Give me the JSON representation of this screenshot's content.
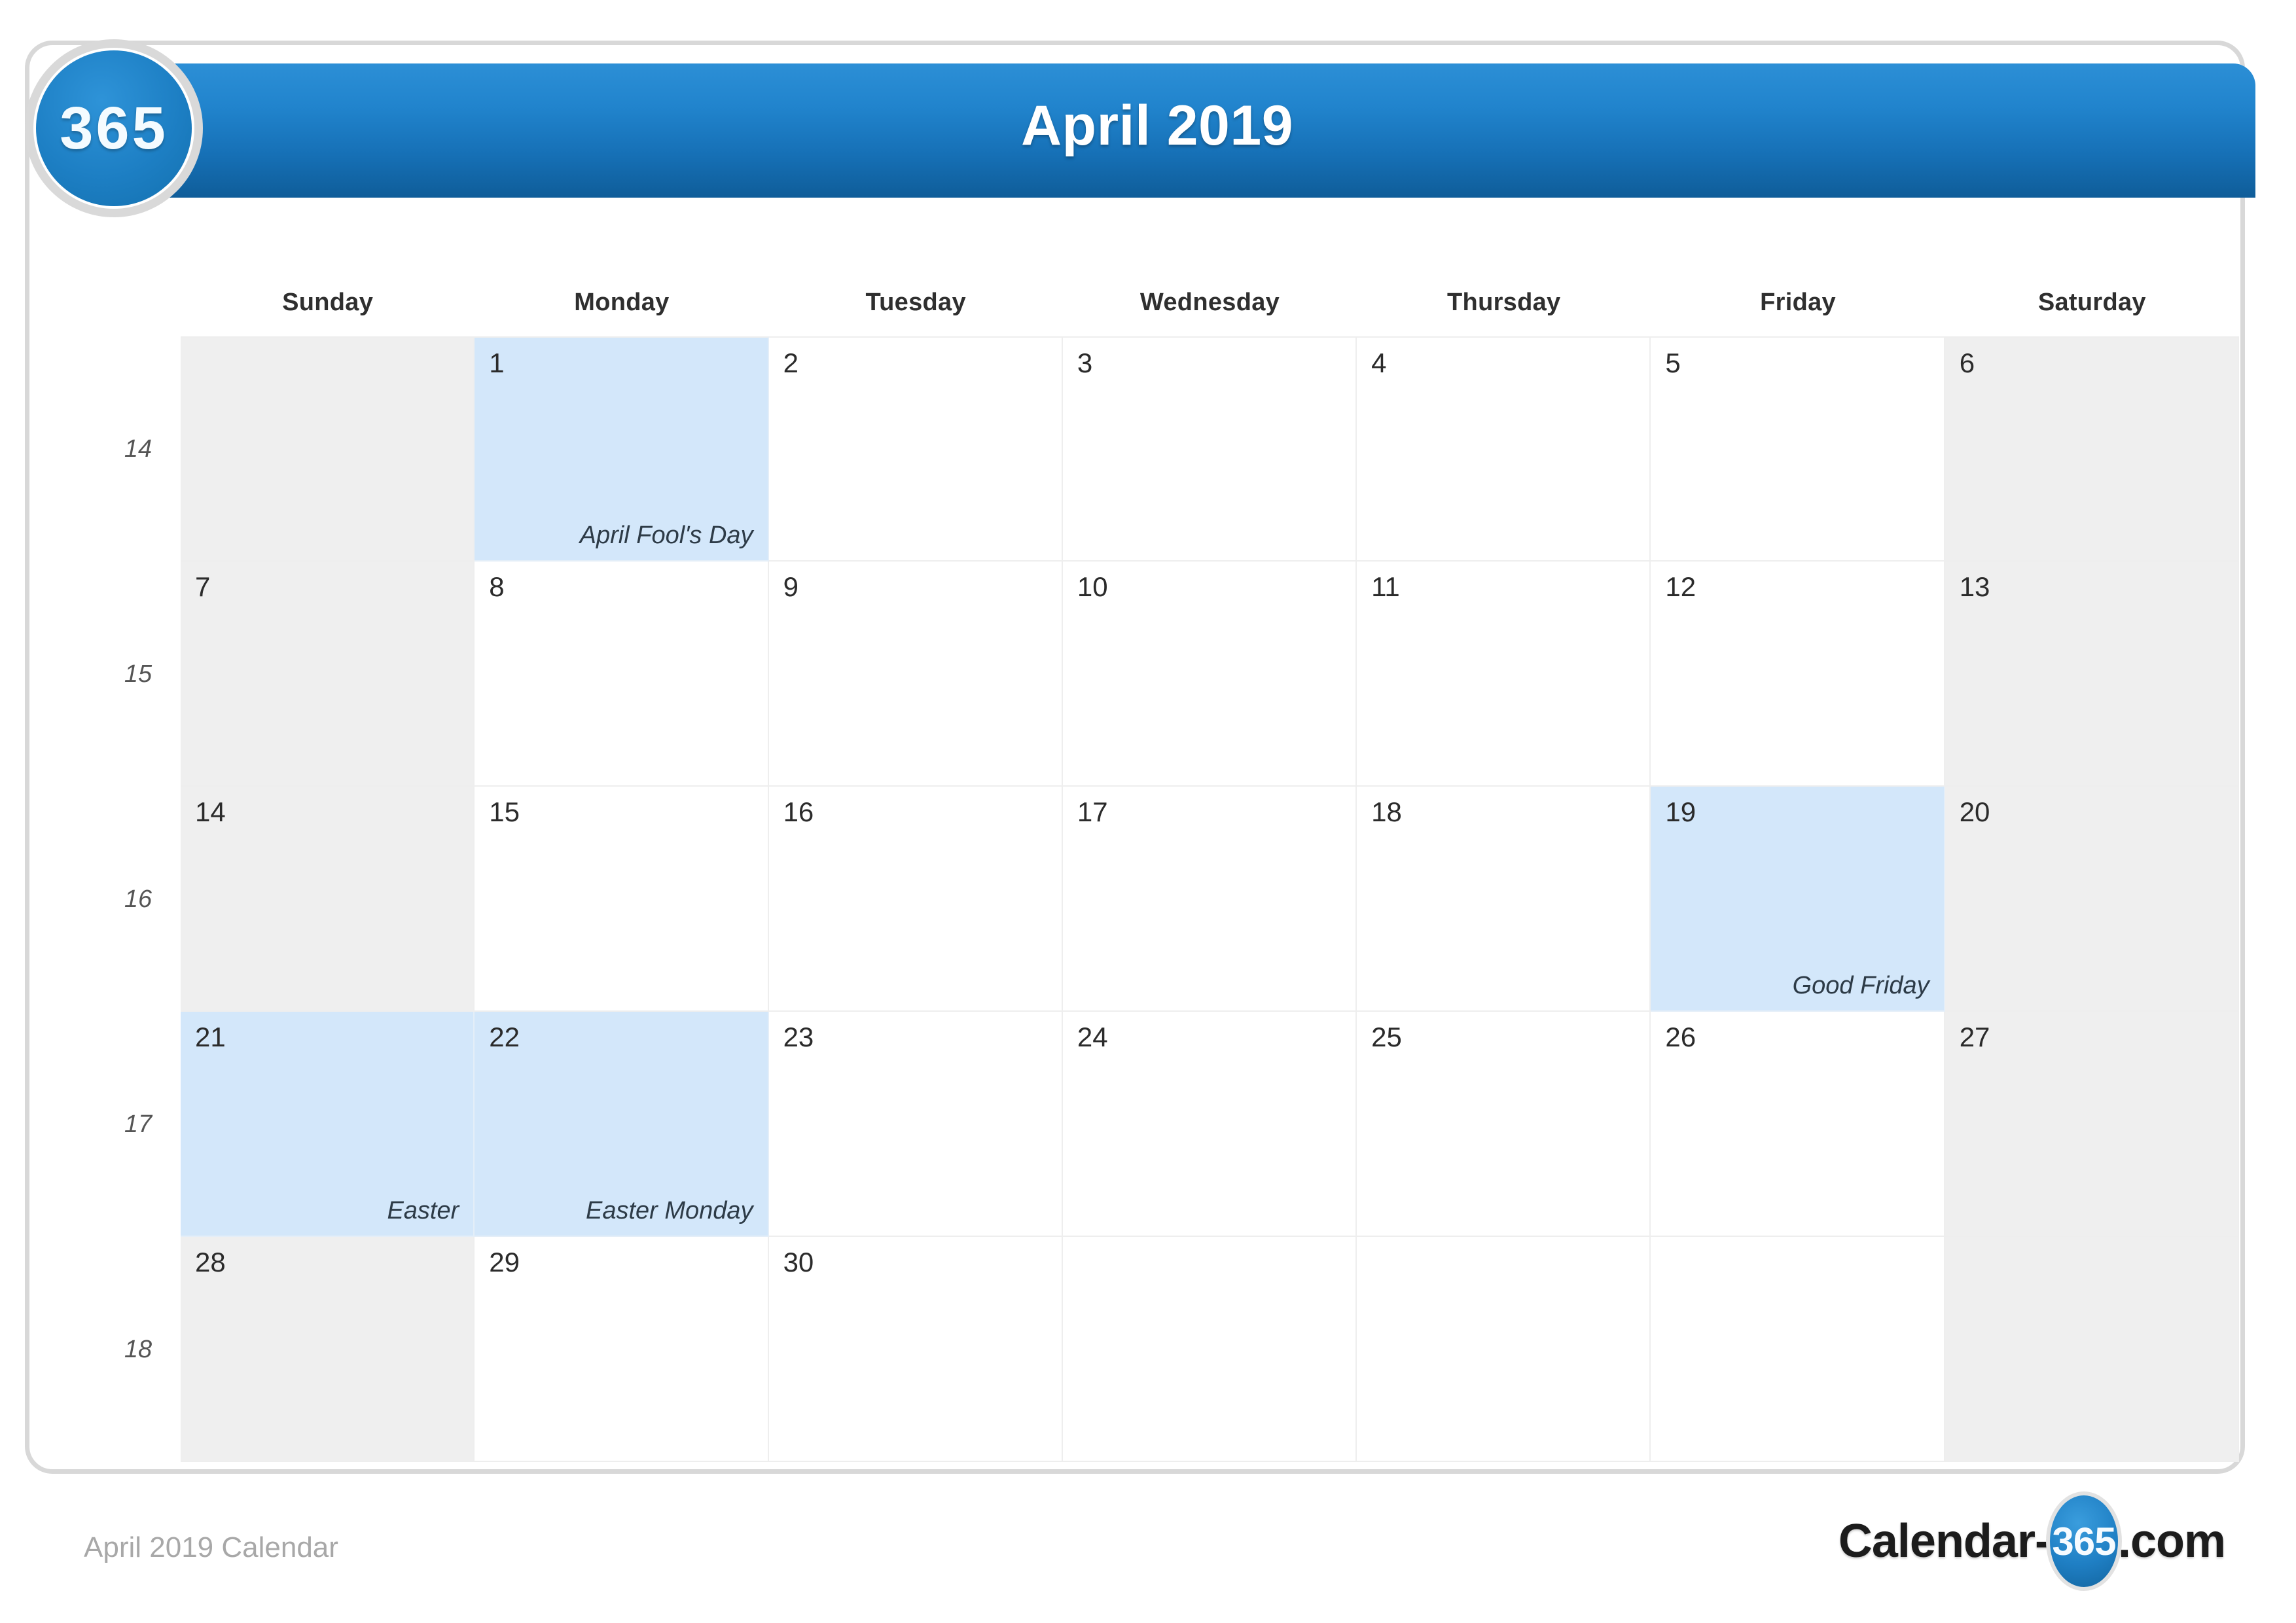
{
  "badge": {
    "label": "365"
  },
  "header": {
    "title": "April 2019"
  },
  "watermark": {
    "text": "365"
  },
  "weekdays": [
    {
      "label": "Sunday"
    },
    {
      "label": "Monday"
    },
    {
      "label": "Tuesday"
    },
    {
      "label": "Wednesday"
    },
    {
      "label": "Thursday"
    },
    {
      "label": "Friday"
    },
    {
      "label": "Saturday"
    }
  ],
  "weeks": [
    {
      "week_number": "14",
      "days": [
        {
          "number": "",
          "event": "",
          "weekend": true,
          "highlight": false
        },
        {
          "number": "1",
          "event": "April Fool's Day",
          "weekend": false,
          "highlight": true
        },
        {
          "number": "2",
          "event": "",
          "weekend": false,
          "highlight": false
        },
        {
          "number": "3",
          "event": "",
          "weekend": false,
          "highlight": false
        },
        {
          "number": "4",
          "event": "",
          "weekend": false,
          "highlight": false
        },
        {
          "number": "5",
          "event": "",
          "weekend": false,
          "highlight": false
        },
        {
          "number": "6",
          "event": "",
          "weekend": true,
          "highlight": false
        }
      ]
    },
    {
      "week_number": "15",
      "days": [
        {
          "number": "7",
          "event": "",
          "weekend": true,
          "highlight": false
        },
        {
          "number": "8",
          "event": "",
          "weekend": false,
          "highlight": false
        },
        {
          "number": "9",
          "event": "",
          "weekend": false,
          "highlight": false
        },
        {
          "number": "10",
          "event": "",
          "weekend": false,
          "highlight": false
        },
        {
          "number": "11",
          "event": "",
          "weekend": false,
          "highlight": false
        },
        {
          "number": "12",
          "event": "",
          "weekend": false,
          "highlight": false
        },
        {
          "number": "13",
          "event": "",
          "weekend": true,
          "highlight": false
        }
      ]
    },
    {
      "week_number": "16",
      "days": [
        {
          "number": "14",
          "event": "",
          "weekend": true,
          "highlight": false
        },
        {
          "number": "15",
          "event": "",
          "weekend": false,
          "highlight": false
        },
        {
          "number": "16",
          "event": "",
          "weekend": false,
          "highlight": false
        },
        {
          "number": "17",
          "event": "",
          "weekend": false,
          "highlight": false
        },
        {
          "number": "18",
          "event": "",
          "weekend": false,
          "highlight": false
        },
        {
          "number": "19",
          "event": "Good Friday",
          "weekend": false,
          "highlight": true
        },
        {
          "number": "20",
          "event": "",
          "weekend": true,
          "highlight": false
        }
      ]
    },
    {
      "week_number": "17",
      "days": [
        {
          "number": "21",
          "event": "Easter",
          "weekend": true,
          "highlight": true
        },
        {
          "number": "22",
          "event": "Easter Monday",
          "weekend": false,
          "highlight": true
        },
        {
          "number": "23",
          "event": "",
          "weekend": false,
          "highlight": false
        },
        {
          "number": "24",
          "event": "",
          "weekend": false,
          "highlight": false
        },
        {
          "number": "25",
          "event": "",
          "weekend": false,
          "highlight": false
        },
        {
          "number": "26",
          "event": "",
          "weekend": false,
          "highlight": false
        },
        {
          "number": "27",
          "event": "",
          "weekend": true,
          "highlight": false
        }
      ]
    },
    {
      "week_number": "18",
      "days": [
        {
          "number": "28",
          "event": "",
          "weekend": true,
          "highlight": false
        },
        {
          "number": "29",
          "event": "",
          "weekend": false,
          "highlight": false
        },
        {
          "number": "30",
          "event": "",
          "weekend": false,
          "highlight": false
        },
        {
          "number": "",
          "event": "",
          "weekend": false,
          "highlight": false
        },
        {
          "number": "",
          "event": "",
          "weekend": false,
          "highlight": false
        },
        {
          "number": "",
          "event": "",
          "weekend": false,
          "highlight": false
        },
        {
          "number": "",
          "event": "",
          "weekend": true,
          "highlight": false
        }
      ]
    }
  ],
  "footer": {
    "caption": "April 2019 Calendar",
    "logo_left": "Calendar-",
    "logo_badge": "365",
    "logo_right": ".com"
  },
  "colors": {
    "header_blue_top": "#2c8fd6",
    "header_blue_bottom": "#0f5d99",
    "highlight_blue": "#d3e7fa",
    "weekend_gray": "#efefef",
    "border_gray": "#d8d8d8"
  }
}
